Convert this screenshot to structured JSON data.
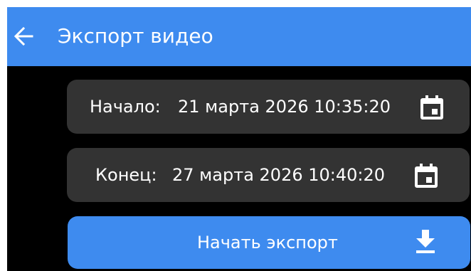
{
  "app_bar": {
    "title": "Экспорт видео",
    "back_icon": "arrow-left-icon",
    "color": "#3e8bef"
  },
  "start": {
    "label": "Начало:",
    "value": "21 марта 2026 10:35:20",
    "icon": "calendar-icon"
  },
  "end": {
    "label": "Конец:",
    "value": "27 марта 2026 10:40:20",
    "icon": "calendar-icon"
  },
  "export_button": {
    "label": "Начать экспорт",
    "icon": "download-icon",
    "color": "#3e8bef"
  },
  "colors": {
    "background": "#000000",
    "card": "#333333",
    "text": "#ffffff"
  }
}
